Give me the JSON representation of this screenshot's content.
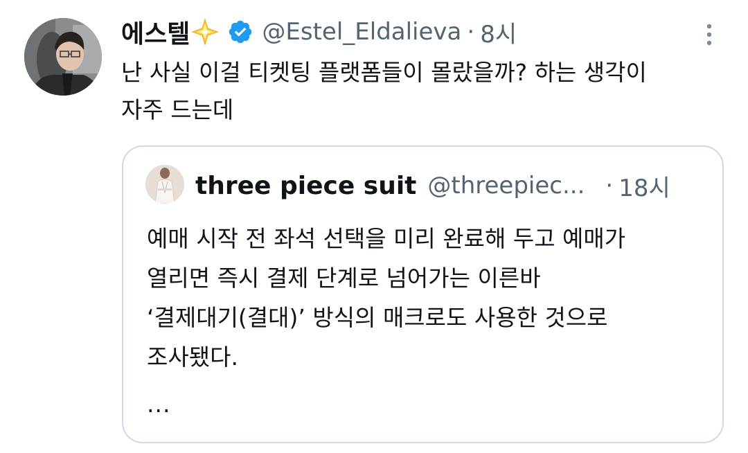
{
  "tweet": {
    "display_name": "에스텔",
    "badge_emoji": "sparkle-star",
    "verified_icon": "verified-badge-icon",
    "handle": "@Estel_Eldalieva",
    "separator": "·",
    "time": "8시",
    "text_lines": [
      "난 사실 이걸 티켓팅 플랫폼들이 몰랐을까? 하는 생각이",
      "자주 드는데"
    ]
  },
  "quoted_tweet": {
    "display_name": "three piece suit",
    "handle": "@threepiec...",
    "separator": "·",
    "time": "18시",
    "text_lines": [
      "예매 시작 전 좌석 선택을 미리 완료해 두고 예매가",
      "열리면 즉시 결제 단계로 넘어가는 이른바",
      "‘결제대기(결대)’ 방식의 매크로도 사용한 것으로",
      "조사됐다."
    ],
    "truncation": "..."
  },
  "colors": {
    "text_primary": "#0f1419",
    "text_secondary": "#536471",
    "verified_blue": "#1d9bf0",
    "border": "#cfd9de"
  }
}
